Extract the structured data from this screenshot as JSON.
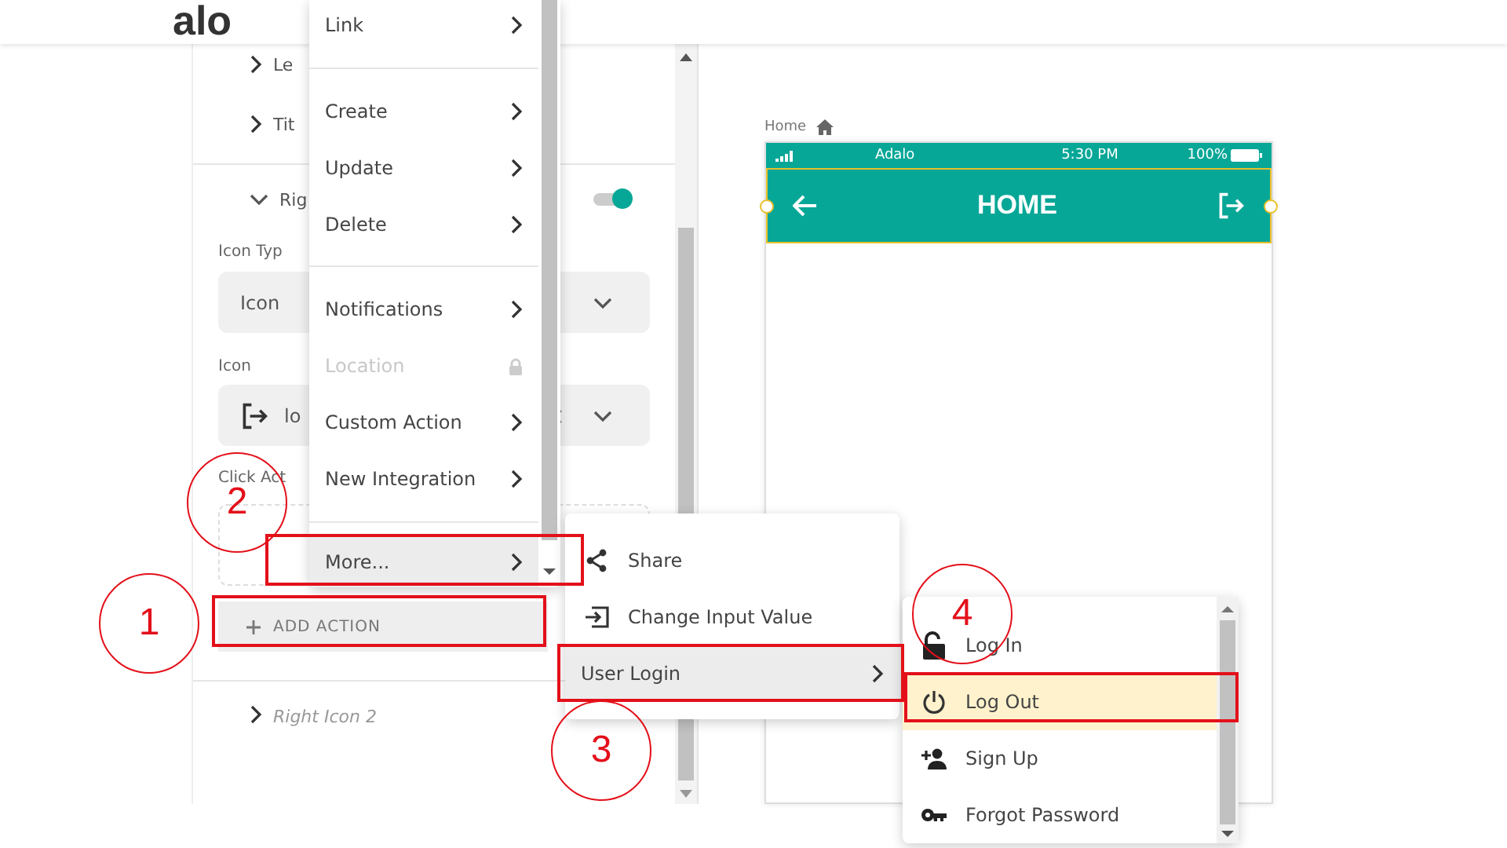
{
  "header": {
    "logo": "alo"
  },
  "panel": {
    "rows": [
      {
        "label": "Le",
        "expanded": false
      },
      {
        "label": "Tit",
        "expanded": false
      }
    ],
    "right_icon": {
      "label": "Rig",
      "expanded": true,
      "on": true,
      "icon_type_label": "Icon Typ",
      "icon_type_value": "Icon",
      "icon_label": "Icon",
      "icon_value": "lo",
      "click_action_label": "Click Act",
      "add_action": "ADD ACTION"
    },
    "next_section": {
      "label": "Right Icon 2",
      "expanded": false
    }
  },
  "canvas": {
    "breadcrumb": "Home",
    "phone": {
      "carrier": "Adalo",
      "time": "5:30 PM",
      "battery": "100%",
      "title": "HOME",
      "selected": true
    }
  },
  "action_menu": {
    "groups": [
      {
        "items": [
          {
            "label": "Link",
            "kind": "submenu",
            "selected": false,
            "disabled": false
          }
        ]
      },
      {
        "items": [
          {
            "label": "Create",
            "kind": "submenu",
            "selected": false,
            "disabled": false
          },
          {
            "label": "Update",
            "kind": "submenu",
            "selected": false,
            "disabled": false
          },
          {
            "label": "Delete",
            "kind": "submenu",
            "selected": false,
            "disabled": false
          }
        ]
      },
      {
        "items": [
          {
            "label": "Notifications",
            "kind": "submenu",
            "selected": false,
            "disabled": false
          },
          {
            "label": "Location",
            "kind": "locked",
            "selected": false,
            "disabled": true
          },
          {
            "label": "Custom Action",
            "kind": "submenu",
            "selected": false,
            "disabled": false
          },
          {
            "label": "New Integration",
            "kind": "submenu",
            "selected": false,
            "disabled": false
          }
        ]
      },
      {
        "items": [
          {
            "label": "More...",
            "kind": "submenu",
            "selected": true,
            "disabled": false
          }
        ]
      }
    ]
  },
  "more_menu": {
    "items": [
      {
        "label": "Share",
        "kind": "share",
        "selected": false
      },
      {
        "label": "Change Input Value",
        "kind": "input",
        "selected": false
      },
      {
        "label": "User Login",
        "kind": "submenu",
        "selected": true
      }
    ]
  },
  "login_menu": {
    "items": [
      {
        "label": "Log In",
        "kind": "login",
        "selected": false
      },
      {
        "label": "Log Out",
        "kind": "logout",
        "selected": true
      },
      {
        "label": "Sign Up",
        "kind": "signup",
        "selected": false
      },
      {
        "label": "Forgot Password",
        "kind": "password",
        "selected": false
      }
    ]
  },
  "annotations": [
    {
      "label": "1"
    },
    {
      "label": "2"
    },
    {
      "label": "3"
    },
    {
      "label": "4"
    }
  ]
}
